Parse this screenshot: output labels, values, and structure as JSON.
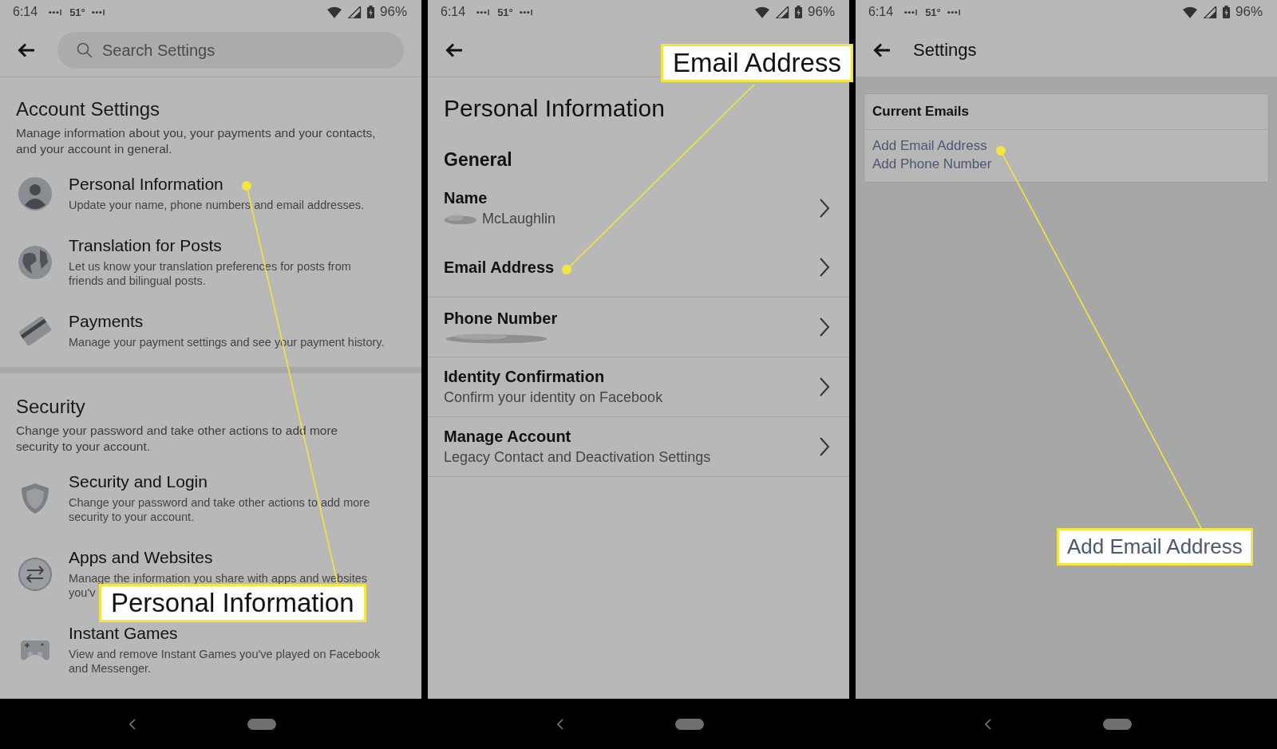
{
  "screens": [
    {
      "kind": "settings_list",
      "status_bar": {
        "time": "6:14",
        "temperature": "51°",
        "battery": "96%"
      },
      "search": {
        "placeholder": "Search Settings"
      },
      "sections": [
        {
          "title": "Account Settings",
          "description_lines": [
            "Manage information about you, your payments and your contacts,",
            "and your account in general."
          ],
          "items": [
            {
              "title": "Personal Information",
              "description_lines": [
                "Update your name, phone numbers and email addresses."
              ]
            },
            {
              "title": "Translation for Posts",
              "description_lines": [
                "Let us know your translation preferences for posts from",
                "friends and bilingual posts."
              ]
            },
            {
              "title": "Payments",
              "description_lines": [
                "Manage your payment settings and see your payment history."
              ]
            }
          ]
        },
        {
          "title": "Security",
          "description_lines": [
            "Change your password and take other actions to add more",
            "security to your account."
          ],
          "items": [
            {
              "title": "Security and Login",
              "description_lines": [
                "Change your password and take other actions to add more",
                "security to your account."
              ]
            },
            {
              "title": "Apps and Websites",
              "description_lines": [
                "Manage the information you share with apps and websites",
                "you'v"
              ]
            },
            {
              "title": "Instant Games",
              "description_lines": [
                "View and remove Instant Games you've played on Facebook",
                "and Messenger."
              ]
            }
          ]
        }
      ],
      "callout": {
        "label": "Personal Information"
      }
    },
    {
      "kind": "personal_info",
      "status_bar": {
        "time": "6:14",
        "temperature": "51°",
        "battery": "96%"
      },
      "title": "Personal Information",
      "section": "General",
      "rows": [
        {
          "label": "Name",
          "value": "McLaughlin",
          "blurred": true
        },
        {
          "label": "Email Address",
          "blurred": false
        },
        {
          "label": "Phone Number",
          "blurred": true
        },
        {
          "label": "Identity Confirmation",
          "value": "Confirm your identity on Facebook",
          "blurred": false
        },
        {
          "label": "Manage Account",
          "value": "Legacy Contact and Deactivation Settings",
          "blurred": false
        }
      ],
      "callout": {
        "label": "Email Address"
      }
    },
    {
      "kind": "emails",
      "status_bar": {
        "time": "6:14",
        "temperature": "51°",
        "battery": "96%"
      },
      "title": "Settings",
      "card": {
        "title": "Current Emails",
        "links": [
          "Add Email Address",
          "Add Phone Number"
        ]
      },
      "callout": {
        "label": "Add Email Address"
      }
    }
  ]
}
